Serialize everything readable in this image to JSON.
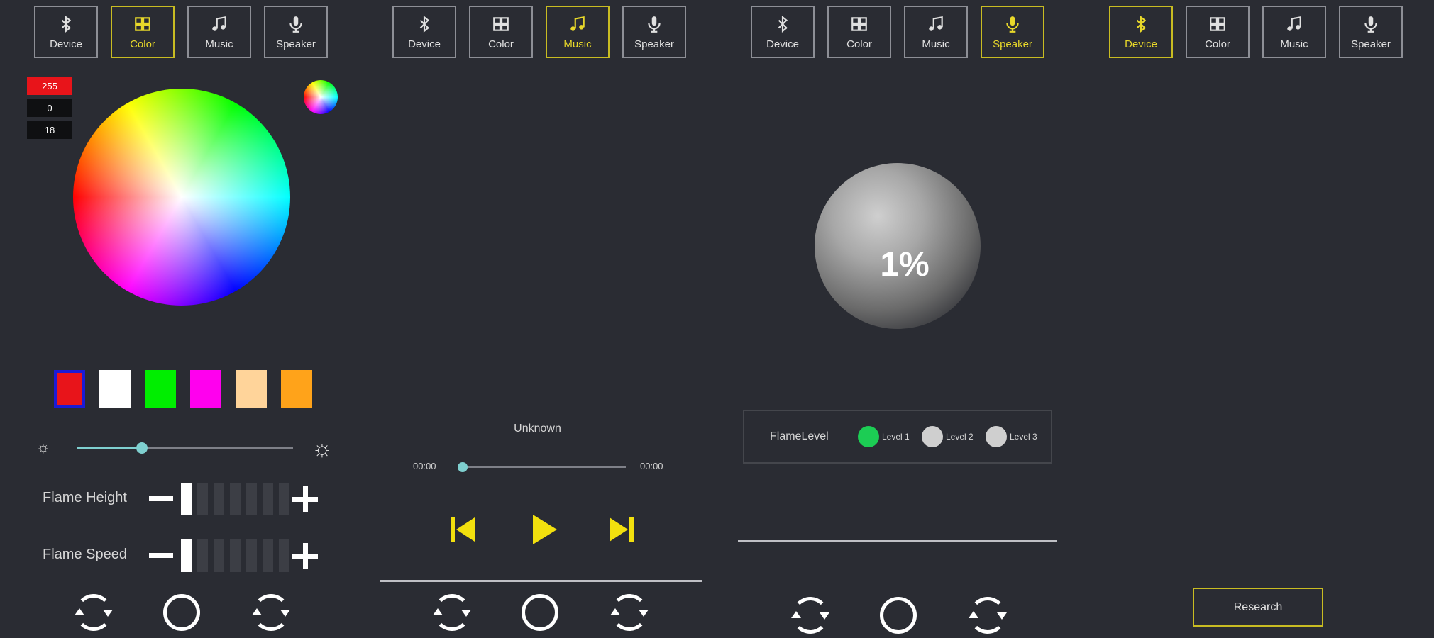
{
  "tabs": [
    {
      "label": "Device",
      "icon": "bluetooth-icon"
    },
    {
      "label": "Color",
      "icon": "color-grid-icon"
    },
    {
      "label": "Music",
      "icon": "music-note-icon"
    },
    {
      "label": "Speaker",
      "icon": "microphone-icon"
    }
  ],
  "active_tabs": {
    "color_panel": "Color",
    "music_panel": "Music",
    "speaker_panel": "Speaker",
    "device_panel": "Device"
  },
  "colors": {
    "accent": "#e8d82a",
    "background": "#2a2c33",
    "active_level": "#1ccd54",
    "slider": "#7fd0d0"
  },
  "color_panel": {
    "rgb": {
      "r": "255",
      "g": "0",
      "b": "18"
    },
    "swatches": [
      "#e8141a",
      "#ffffff",
      "#00ee00",
      "#ff00ee",
      "#ffd49a",
      "#ffa31a"
    ],
    "selected_swatch": 0,
    "brightness": 0.3,
    "flame_height": {
      "label": "Flame Height",
      "level": 1,
      "max": 7
    },
    "flame_speed": {
      "label": "Flame Speed",
      "level": 1,
      "max": 7
    }
  },
  "music_panel": {
    "track_title": "Unknown",
    "time_current": "00:00",
    "time_total": "00:00",
    "progress": 0
  },
  "speaker_panel": {
    "volume": "1%",
    "flame_level_label": "FlameLevel",
    "levels": [
      "Level 1",
      "Level 2",
      "Level 3"
    ],
    "selected_level": 0
  },
  "device_panel": {
    "research_label": "Research"
  },
  "bottom_bar": {
    "left_icon": "cycle-in-icon",
    "center_icon": "power-ring-icon",
    "right_icon": "cycle-out-icon"
  }
}
